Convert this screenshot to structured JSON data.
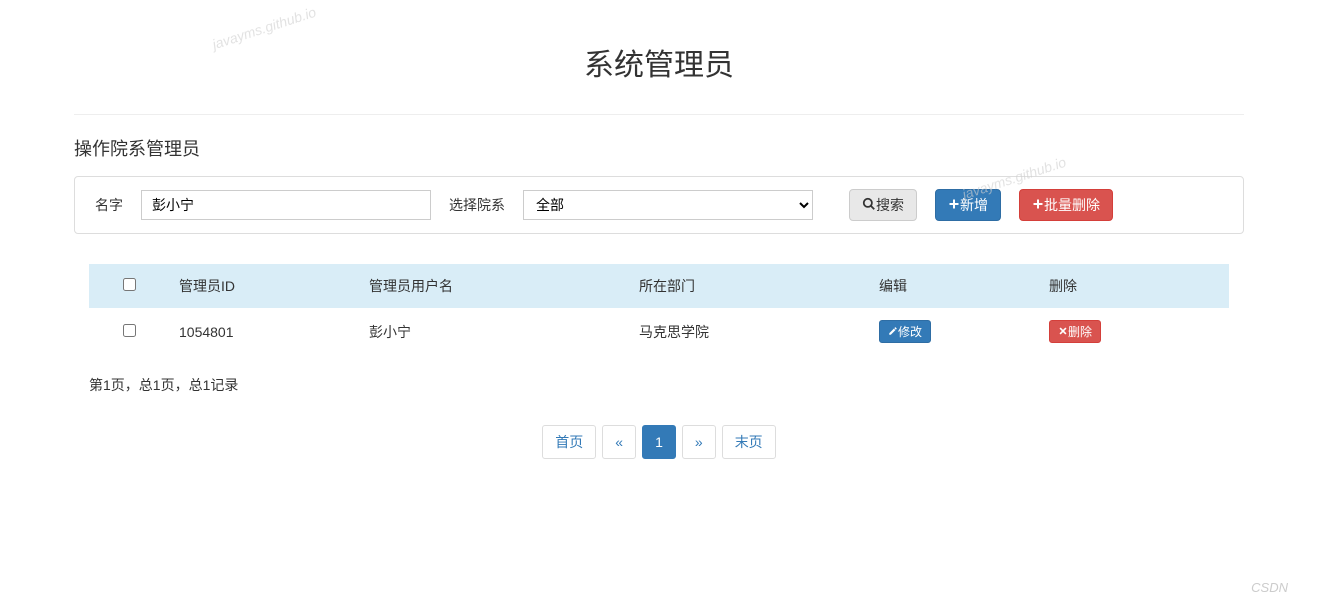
{
  "watermark": "javayms.github.io",
  "page_title": "系统管理员",
  "sub_title": "操作院系管理员",
  "search": {
    "name_label": "名字",
    "name_value": "彭小宁",
    "dept_label": "选择院系",
    "dept_selected": "全部",
    "search_btn": "搜索",
    "add_btn": "新增",
    "bulk_delete_btn": "批量删除"
  },
  "table": {
    "headers": {
      "admin_id": "管理员ID",
      "username": "管理员用户名",
      "department": "所在部门",
      "edit": "编辑",
      "delete": "删除"
    },
    "rows": [
      {
        "id": "1054801",
        "username": "彭小宁",
        "department": "马克思学院",
        "edit_label": "修改",
        "delete_label": "删除"
      }
    ]
  },
  "page_info": "第1页，总1页，总1记录",
  "pagination": {
    "first": "首页",
    "prev": "«",
    "current": "1",
    "next": "»",
    "last": "末页"
  },
  "footer_mark": "CSDN"
}
